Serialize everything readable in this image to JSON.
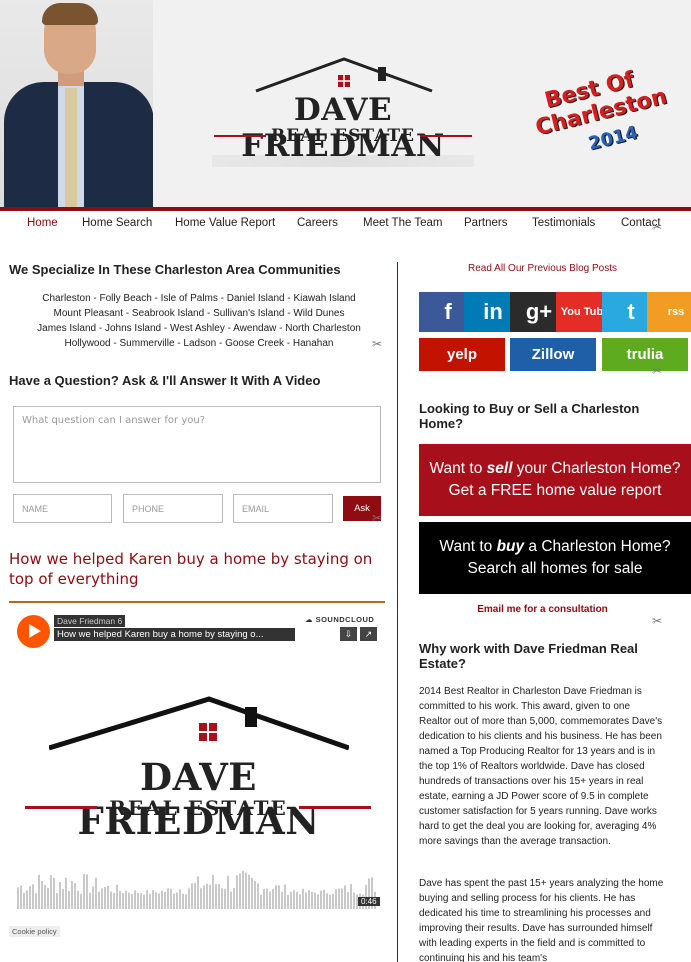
{
  "header": {
    "brand_name": "DAVE FRIEDMAN",
    "brand_sub": "REAL ESTATE",
    "award": {
      "line1": "Best Of",
      "line2": "Charleston",
      "year": "2014"
    }
  },
  "nav": {
    "items": [
      {
        "label": "Home",
        "active": true
      },
      {
        "label": "Home Search"
      },
      {
        "label": "Home Value Report"
      },
      {
        "label": "Careers"
      },
      {
        "label": "Meet The Team"
      },
      {
        "label": "Partners"
      },
      {
        "label": "Testimonials"
      },
      {
        "label": "Contact"
      }
    ]
  },
  "left": {
    "communities_heading": "We Specialize In These Charleston Area Communities",
    "communities": [
      "Charleston - Folly Beach - Isle of Palms - Daniel Island - Kiawah Island",
      "Mount Pleasant - Seabrook Island - Sullivan's Island - Wild Dunes",
      "James Island - Johns Island - West Ashley - Awendaw - North Charleston",
      "Hollywood - Summerville - Ladson - Goose Creek - Hanahan"
    ],
    "question_heading": "Have a Question? Ask & I'll Answer It With A Video",
    "question_placeholder": "What question can I answer for you?",
    "name_placeholder": "NAME",
    "phone_placeholder": "PHONE",
    "email_placeholder": "EMAIL",
    "ask_label": "Ask",
    "story_title": "How we helped Karen buy a home by staying on top of everything",
    "player": {
      "user": "Dave Friedman 6",
      "track": "How we helped Karen buy a home by staying o...",
      "provider": "SOUNDCLOUD",
      "duration": "0:46",
      "cookie": "Cookie policy"
    }
  },
  "right": {
    "blog_link": "Read All Our Previous Blog Posts",
    "social": [
      {
        "icon": "facebook-icon",
        "label": "f",
        "color": "#3b5998"
      },
      {
        "icon": "linkedin-icon",
        "label": "in",
        "color": "#007bb6"
      },
      {
        "icon": "googleplus-icon",
        "label": "g+",
        "color": "#2b2b2b"
      },
      {
        "icon": "youtube-icon",
        "label": "You Tube",
        "color": "#e52d27"
      },
      {
        "icon": "twitter-icon",
        "label": "t",
        "color": "#2aa9e0"
      },
      {
        "icon": "rss-icon",
        "label": "rss",
        "color": "#f39c23"
      }
    ],
    "wide_social": [
      {
        "icon": "yelp-icon",
        "label": "yelp",
        "color": "#c41200"
      },
      {
        "icon": "zillow-icon",
        "label": "Zillow",
        "color": "#1f5fa8"
      },
      {
        "icon": "trulia-icon",
        "label": "trulia",
        "color": "#5eab1f"
      }
    ],
    "buy_sell_heading": "Looking to Buy or Sell a Charleston Home?",
    "sell_cta": {
      "pre": "Want to ",
      "em": "sell",
      "post": " your Charleston Home?",
      "line2": "Get a FREE home value report"
    },
    "buy_cta": {
      "pre": "Want to ",
      "em": "buy",
      "post": " a Charleston Home?",
      "line2": "Search all homes for sale"
    },
    "email_link": "Email me for a consultation",
    "why_heading": "Why work with Dave Friedman Real Estate?",
    "why_p1": "2014 Best Realtor in Charleston Dave Friedman is committed to his work. This award, given to one Realtor out of more than 5,000, commemorates Dave's dedication to his clients and his business. He has been named a Top Producing Realtor for 13 years and is in the top 1% of Realtors worldwide. Dave has closed hundreds of transactions over his 15+ years in real estate, earning a JD Power score of 9.5 in complete customer satisfaction for 5 years running. Dave works hard to get the deal you are looking for, averaging 4% more savings than the average transaction.",
    "why_p2": "Dave has spent the past 15+ years analyzing the home buying and selling process for his clients. He has dedicated his time to streamlining his processes and improving their results. Dave has surrounded himself with leading experts in the field and is committed to continuing his and his team's"
  },
  "colors": {
    "brand_red": "#8e0c12",
    "cta_red": "#a70f1a",
    "cta_black": "#000000",
    "accent_orange": "#ff5500"
  }
}
